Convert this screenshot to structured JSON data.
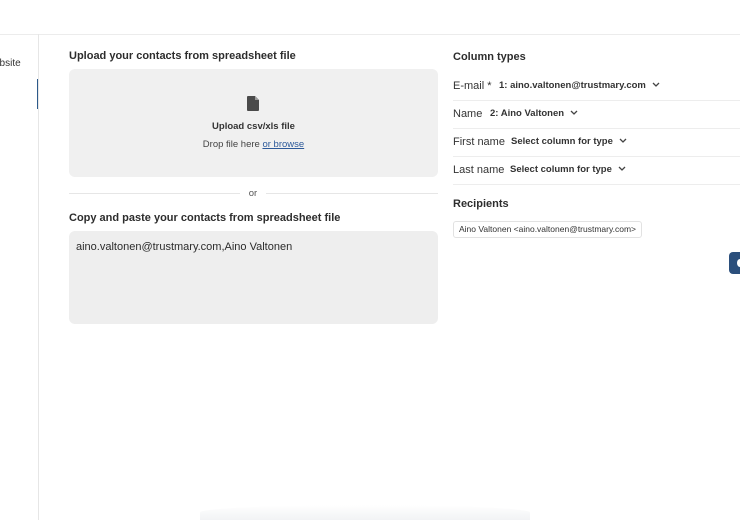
{
  "sidebar": {
    "items": [
      {
        "label": "ebsite"
      }
    ]
  },
  "upload": {
    "title": "Upload your contacts from spreadsheet file",
    "icon": "file-icon",
    "label": "Upload csv/xls file",
    "drop_text": "Drop file here",
    "browse_label": "or browse"
  },
  "divider": {
    "label": "or"
  },
  "paste": {
    "title": "Copy and paste your contacts from spreadsheet file",
    "value": "aino.valtonen@trustmary.com,Aino Valtonen"
  },
  "column_types": {
    "title": "Column types",
    "rows": [
      {
        "label": "E-mail *",
        "value": "1: aino.valtonen@trustmary.com"
      },
      {
        "label": "Name",
        "value": "2: Aino Valtonen"
      },
      {
        "label": "First name",
        "value": "Select column for type"
      },
      {
        "label": "Last name",
        "value": "Select column for type"
      }
    ]
  },
  "recipients": {
    "title": "Recipients",
    "items": [
      "Aino Valtonen <aino.valtonen@trustmary.com>"
    ]
  },
  "colors": {
    "accent": "#2b4f7c",
    "link": "#2d5a9a",
    "panel_bg": "#f0f0f0"
  }
}
